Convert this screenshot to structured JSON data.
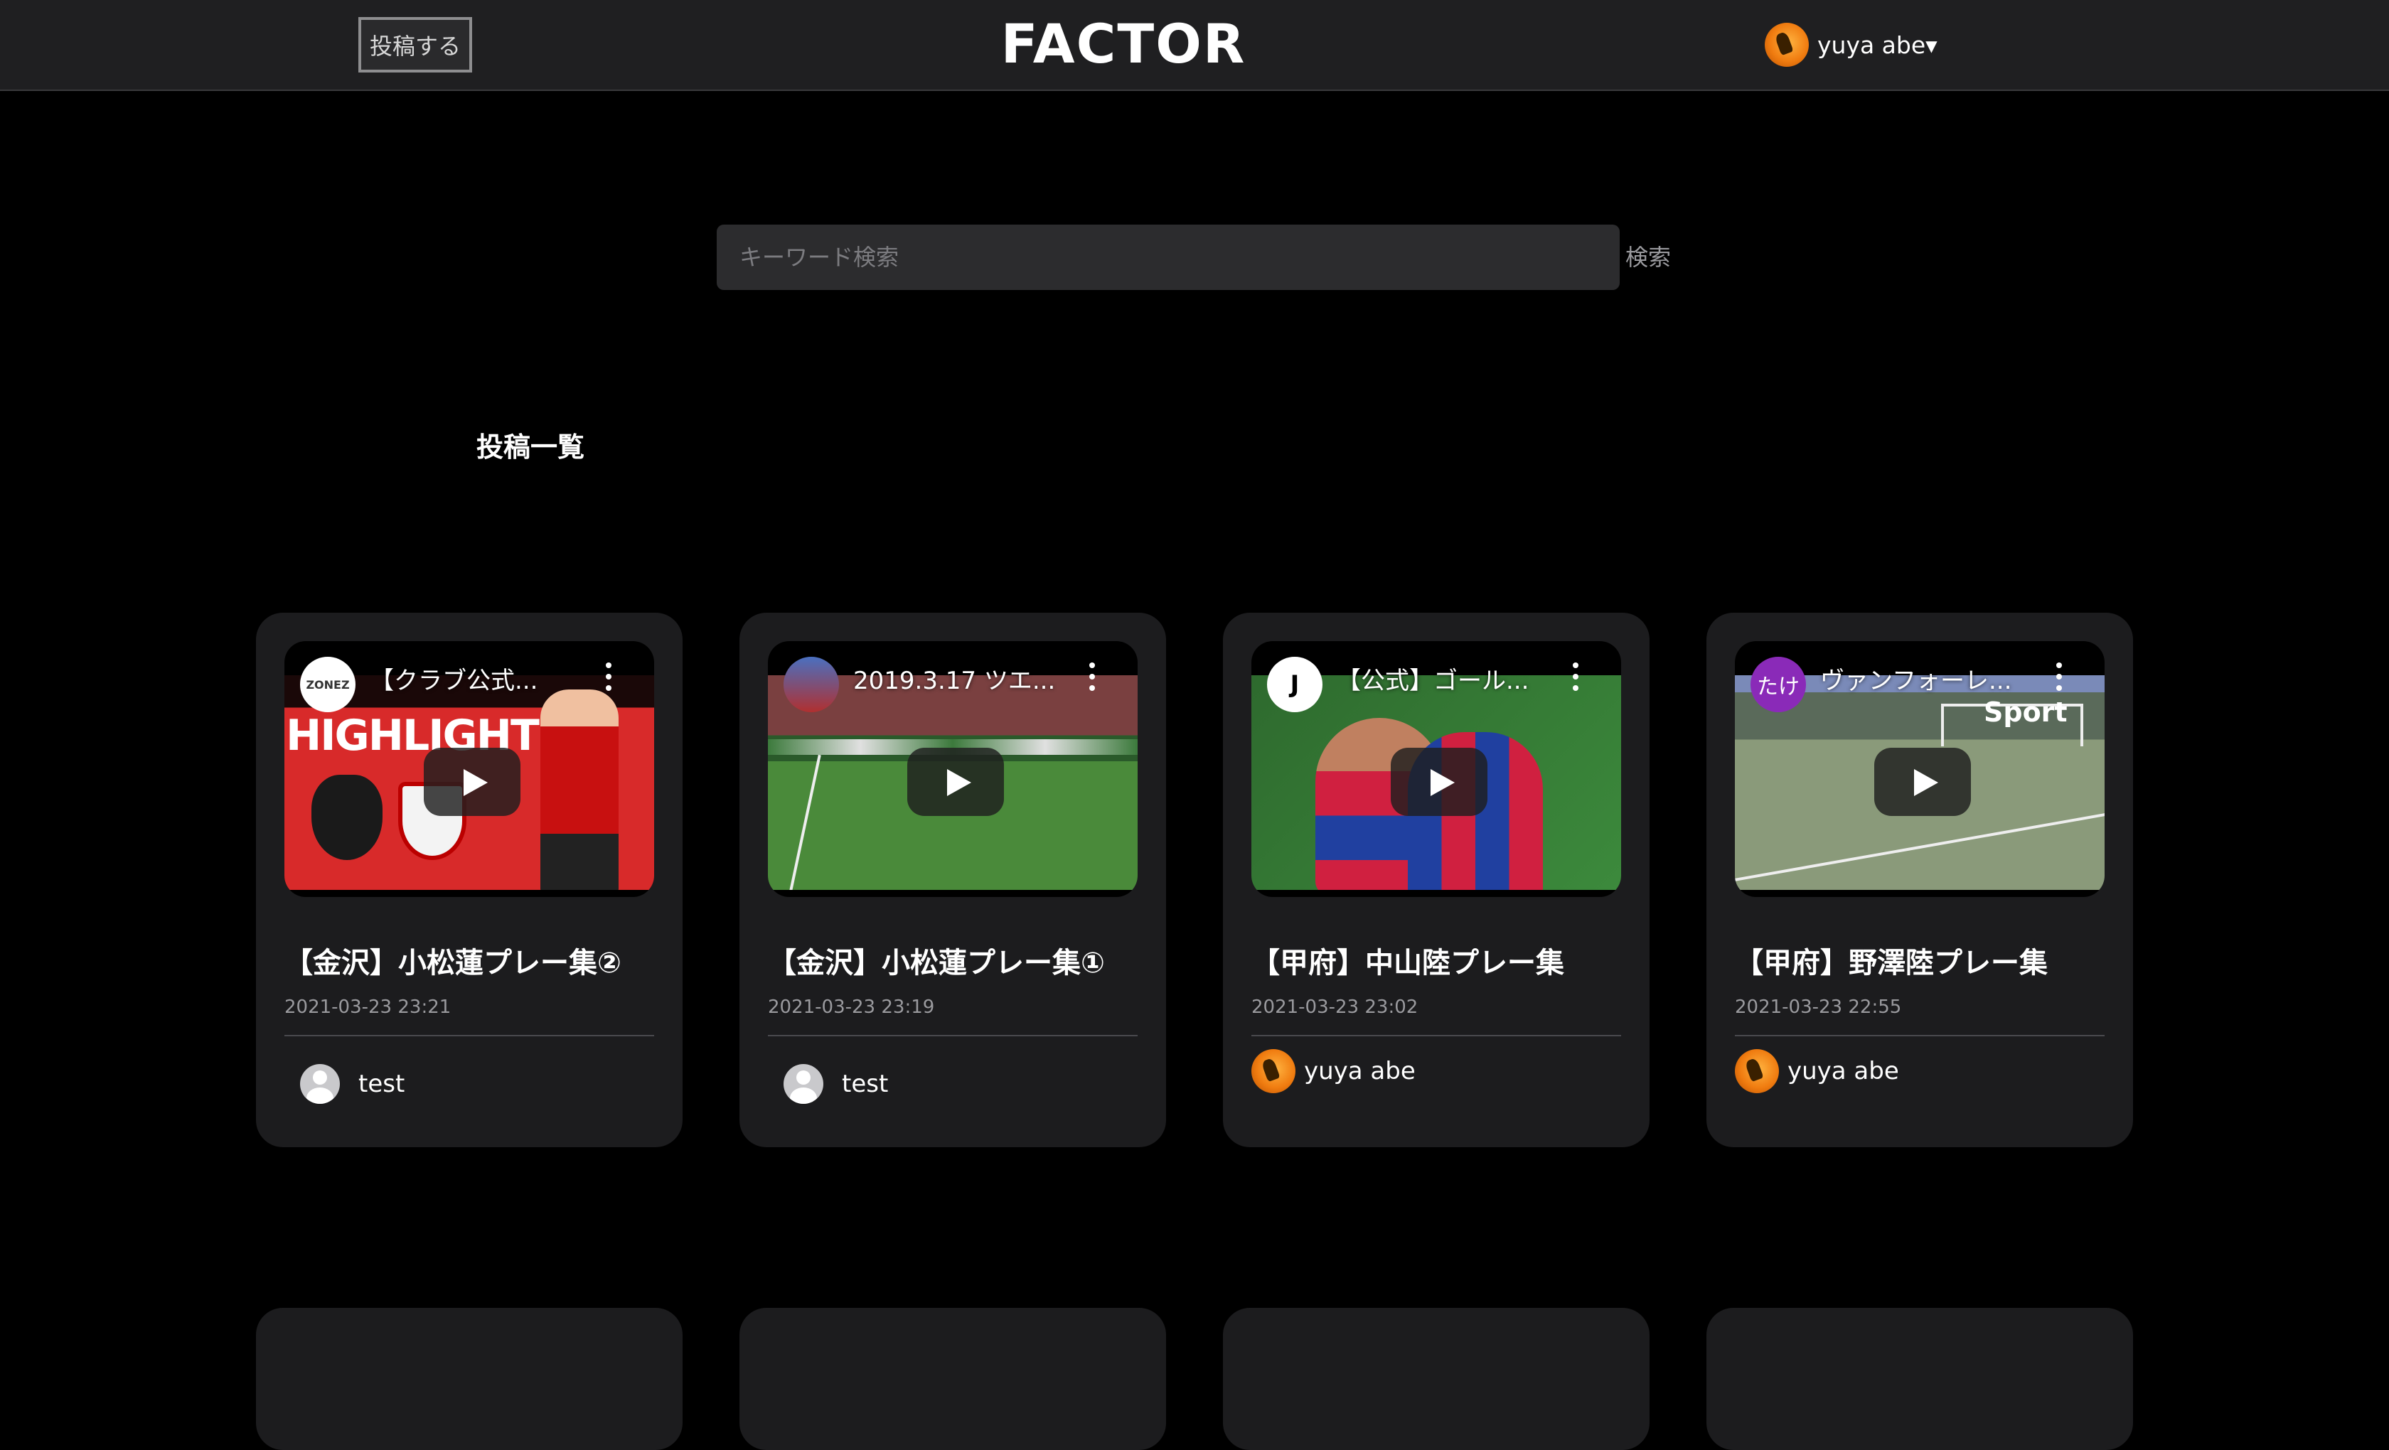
{
  "header": {
    "post_button": "投稿する",
    "brand": "FACTOR",
    "user_name": "yuya abe▾"
  },
  "search": {
    "placeholder": "キーワード検索",
    "button": "検索"
  },
  "section_title": "投稿一覧",
  "posts": [
    {
      "video_title": "【クラブ公式...",
      "title": "【金沢】小松蓮プレー集②",
      "date": "2021-03-23 23:21",
      "author": "test",
      "channel_label": "ZONEZ",
      "thumb_text": "HIGHLIGHTS"
    },
    {
      "video_title": "2019.3.17 ツエ...",
      "title": "【金沢】小松蓮プレー集①",
      "date": "2021-03-23 23:19",
      "author": "test",
      "channel_label": ""
    },
    {
      "video_title": "【公式】ゴール...",
      "title": "【甲府】中山陸プレー集",
      "date": "2021-03-23 23:02",
      "author": "yuya abe",
      "channel_label": "J"
    },
    {
      "video_title": "ヴァンフォーレ...",
      "title": "【甲府】野澤陸プレー集",
      "date": "2021-03-23 22:55",
      "author": "yuya abe",
      "channel_label": "たけ",
      "thumb_text": "Sport"
    }
  ],
  "colors": {
    "background": "#000000",
    "header_bg": "#1f1f21",
    "card_bg": "#1c1c1e",
    "search_bg": "#2c2c2e",
    "muted_text": "#9a9a9e"
  }
}
